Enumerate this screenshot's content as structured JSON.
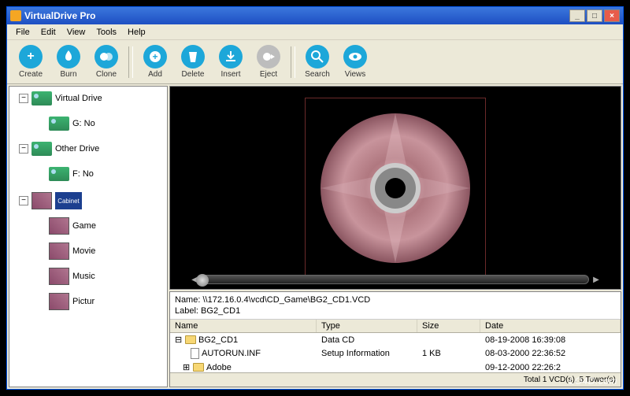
{
  "window": {
    "title": "VirtualDrive Pro"
  },
  "menu": {
    "file": "File",
    "edit": "Edit",
    "view": "View",
    "tools": "Tools",
    "help": "Help"
  },
  "toolbar": {
    "create": "Create",
    "burn": "Burn",
    "clone": "Clone",
    "add": "Add",
    "delete": "Delete",
    "insert": "Insert",
    "eject": "Eject",
    "search": "Search",
    "views": "Views"
  },
  "tree": {
    "virtual_drive": "Virtual Drive",
    "g_no": "G: No",
    "other_drive": "Other Drive",
    "f_no": "F: No",
    "cabinet": "Cabinet",
    "game": "Game",
    "movie": "Movie",
    "music": "Music",
    "pictur": "Pictur"
  },
  "info": {
    "name_label": "Name:",
    "name_value": "\\\\172.16.0.4\\vcd\\CD_Game\\BG2_CD1.VCD",
    "label_label": "Label:",
    "label_value": "BG2_CD1"
  },
  "table": {
    "headers": {
      "name": "Name",
      "type": "Type",
      "size": "Size",
      "date": "Date"
    },
    "rows": [
      {
        "name": "BG2_CD1",
        "type": "Data CD",
        "size": "",
        "date": "08-19-2008 16:39:08",
        "icon": "folder"
      },
      {
        "name": "AUTORUN.INF",
        "type": "Setup Information",
        "size": "1 KB",
        "date": "08-03-2000 22:36:52",
        "icon": "file"
      },
      {
        "name": "Adobe",
        "type": "",
        "size": "",
        "date": "09-12-2000 22:26:2",
        "icon": "folder"
      }
    ]
  },
  "status": {
    "text": "Total 1 VCD(s), 5 Tower(s)"
  },
  "watermark": "LO4D.com"
}
